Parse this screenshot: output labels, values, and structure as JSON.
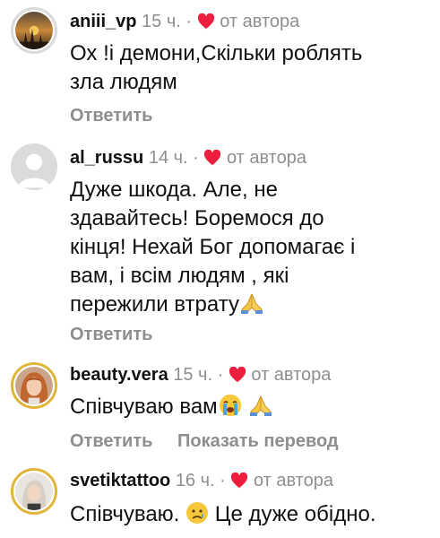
{
  "comments": [
    {
      "username": "aniii_vp",
      "time": "15 ч.",
      "separator": "·",
      "liked_label": "от автора",
      "lines": [
        "Ох !і демони,Скільки роблять",
        "зла людям"
      ],
      "reply_label": "Ответить",
      "avatar_icon": "sunset-photo-avatar"
    },
    {
      "username": "al_russu",
      "time": "14 ч.",
      "separator": "·",
      "liked_label": "от автора",
      "lines": [
        "Дуже шкода.  Але, не",
        "здавайтесь! Боремося до",
        "кінця! Нехай Бог допомагає і",
        "вам, і всім людям , які",
        "пережили втрату"
      ],
      "line_end_emoji": "folded-hands",
      "reply_label": "Ответить",
      "avatar_icon": "default-user-avatar"
    },
    {
      "username": "beauty.vera",
      "time": "15 ч.",
      "separator": "·",
      "liked_label": "от автора",
      "lines": [
        "Співчуваю вам"
      ],
      "line_end_emoji": "crying-face folded-hands",
      "reply_label": "Ответить",
      "translate_label": "Показать перевод",
      "avatar_icon": "woman-portrait-avatar"
    },
    {
      "username": "svetiktattoo",
      "time": "16 ч.",
      "separator": "·",
      "liked_label": "от автора",
      "lines": [
        "Співчуваю.",
        "Це дуже обідно."
      ],
      "inline_emoji": "sad-tear-face",
      "avatar_icon": "woman-portrait-avatar"
    }
  ],
  "colors": {
    "heart": "#ed1d3e",
    "muted": "#8e8e8e",
    "text": "#111111"
  }
}
